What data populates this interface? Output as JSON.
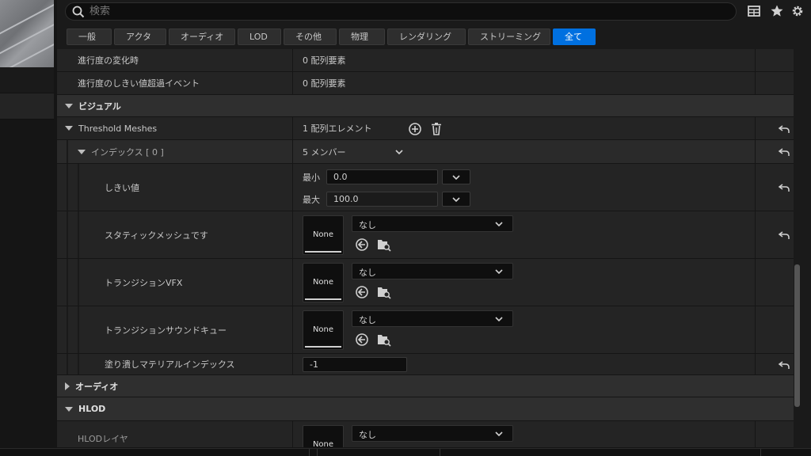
{
  "search": {
    "placeholder": "検索"
  },
  "filters": [
    {
      "label": "一般",
      "active": false
    },
    {
      "label": "アクタ",
      "active": false
    },
    {
      "label": "オーディオ",
      "active": false
    },
    {
      "label": "LOD",
      "active": false
    },
    {
      "label": "その他",
      "active": false
    },
    {
      "label": "物理",
      "active": false
    },
    {
      "label": "レンダリング",
      "active": false
    },
    {
      "label": "ストリーミング",
      "active": false
    },
    {
      "label": "全て",
      "active": true
    }
  ],
  "rows": {
    "progress_changed": {
      "name": "進行度の変化時",
      "value": "0 配列要素"
    },
    "progress_threshold": {
      "name": "進行度のしきい値超過イベント",
      "value": "0 配列要素"
    },
    "visual_category": {
      "name": "ビジュアル"
    },
    "threshold_meshes": {
      "name": "Threshold Meshes",
      "value": "1 配列エレメント"
    },
    "index0": {
      "name": "インデックス [ 0 ]",
      "value": "5 メンバー"
    },
    "threshold": {
      "name": "しきい値",
      "min_label": "最小",
      "min_value": "0.0",
      "max_label": "最大",
      "max_value": "100.0"
    },
    "static_mesh": {
      "name": "スタティックメッシュです",
      "thumb": "None",
      "combo": "なし"
    },
    "transition_vfx": {
      "name": "トランジションVFX",
      "thumb": "None",
      "combo": "なし"
    },
    "transition_sound": {
      "name": "トランジションサウンドキュー",
      "thumb": "None",
      "combo": "なし"
    },
    "fill_material_index": {
      "name": "塗り潰しマテリアルインデックス",
      "value": "-1"
    },
    "audio_category": {
      "name": "オーディオ"
    },
    "hlod_category": {
      "name": "HLOD"
    },
    "hlod_layer": {
      "name": "HLODレイヤ",
      "thumb": "None",
      "combo": "なし"
    }
  },
  "colors": {
    "accent": "#0070e0",
    "panel": "#242424",
    "category": "#2f2f2f"
  }
}
